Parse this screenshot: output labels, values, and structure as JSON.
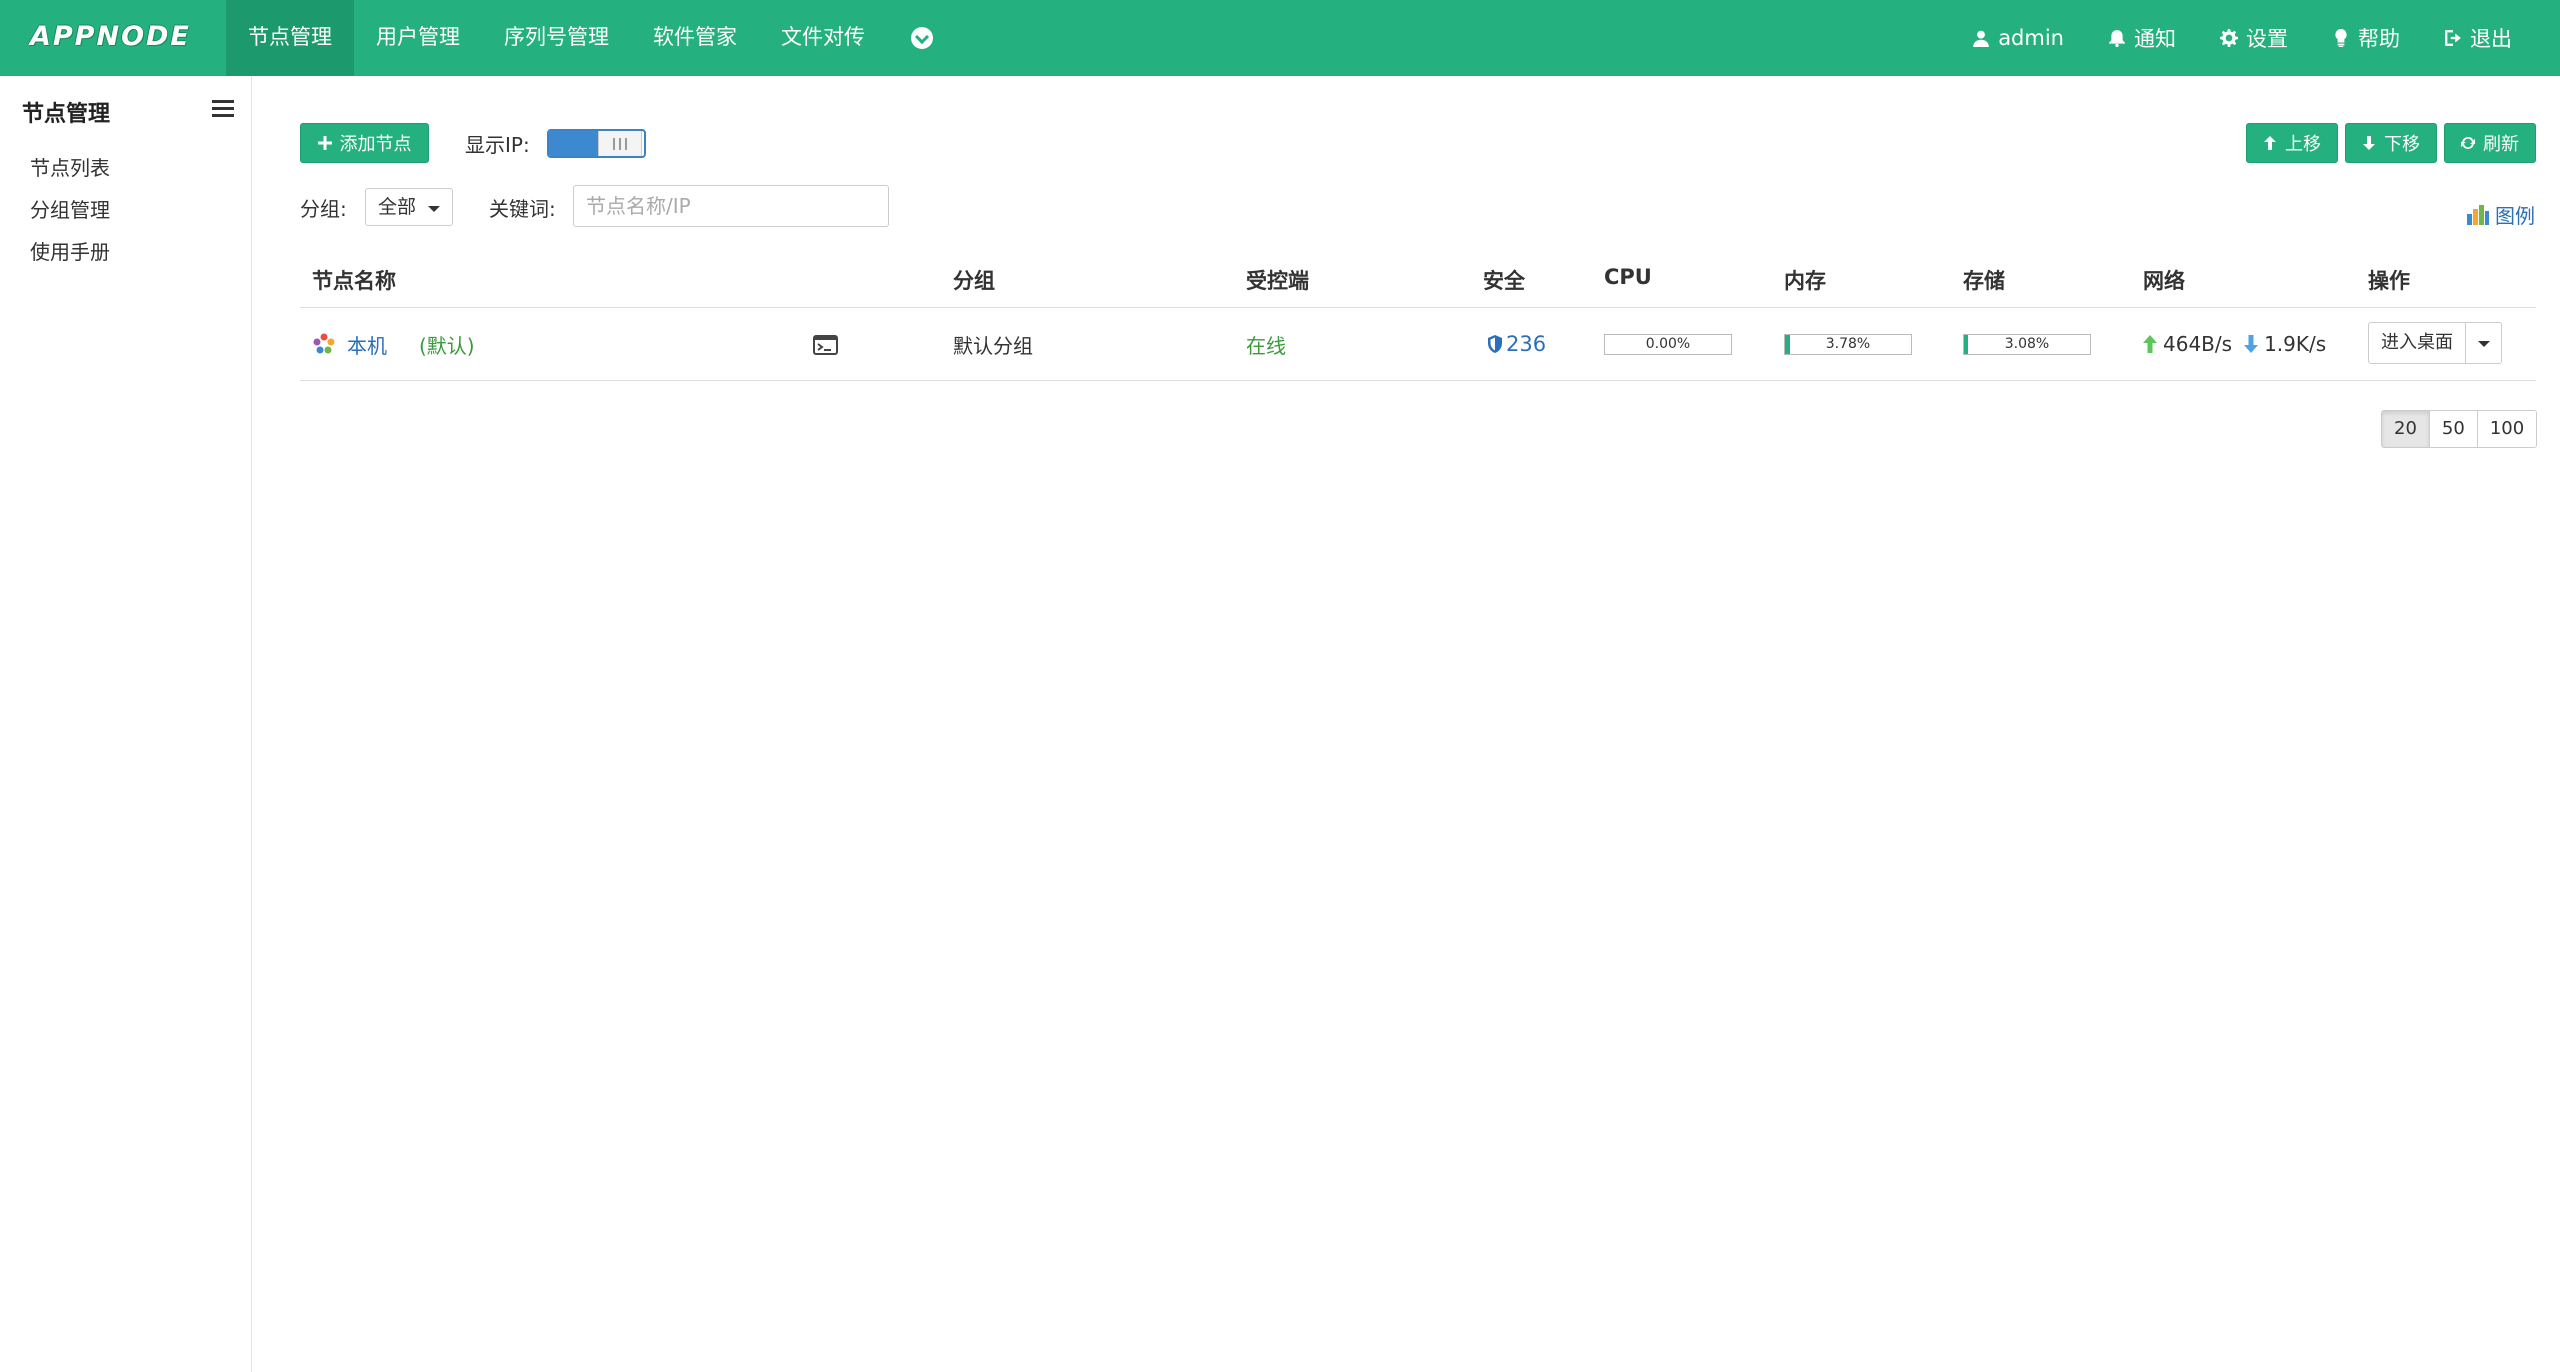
{
  "brand": {
    "logo": "APPNODE"
  },
  "nav": {
    "items": [
      "节点管理",
      "用户管理",
      "序列号管理",
      "软件管家",
      "文件对传"
    ],
    "active_index": 0,
    "more_icon": "chevron-down-circle-icon"
  },
  "right_nav": {
    "user": "admin",
    "notify": "通知",
    "settings": "设置",
    "help": "帮助",
    "logout": "退出"
  },
  "sidebar": {
    "title": "节点管理",
    "items": [
      "节点列表",
      "分组管理",
      "使用手册"
    ]
  },
  "toolbar": {
    "add_node": "添加节点",
    "show_ip_label": "显示IP:",
    "show_ip_on": true,
    "move_up": "上移",
    "move_down": "下移",
    "refresh": "刷新"
  },
  "filters": {
    "group_label": "分组:",
    "group_value": "全部",
    "keyword_label": "关键词:",
    "keyword_placeholder": "节点名称/IP",
    "keyword_value": ""
  },
  "legend_link": "图例",
  "table": {
    "headers": {
      "name": "节点名称",
      "group": "分组",
      "agent": "受控端",
      "security": "安全",
      "cpu": "CPU",
      "memory": "内存",
      "storage": "存储",
      "network": "网络",
      "actions": "操作"
    },
    "rows": [
      {
        "name": "本机",
        "tag": "(默认)",
        "group": "默认分组",
        "agent_status": "在线",
        "security": "236",
        "cpu": "0.00%",
        "cpu_value": 0.0,
        "memory": "3.78%",
        "memory_value": 3.78,
        "storage": "3.08%",
        "storage_value": 3.08,
        "net_up": "464B/s",
        "net_down": "1.9K/s",
        "action": "进入桌面"
      }
    ]
  },
  "pagination": {
    "sizes": [
      "20",
      "50",
      "100"
    ],
    "active": "20"
  },
  "colors": {
    "primary": "#24b07f",
    "link": "#2a6fb8",
    "online": "#3a9a3a"
  }
}
